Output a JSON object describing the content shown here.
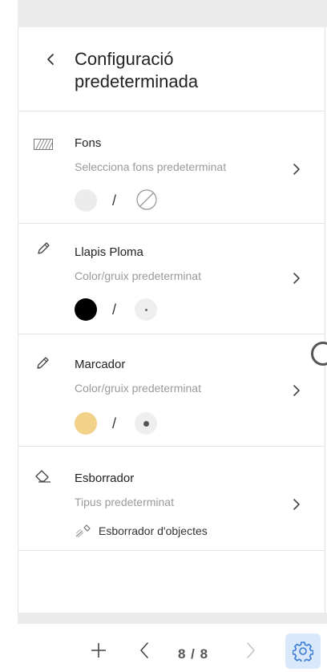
{
  "header": {
    "title": "Configuració predeterminada"
  },
  "sections": [
    {
      "title": "Fons",
      "subtitle": "Selecciona fons predeterminat",
      "icon": "background-pattern-icon",
      "preview": {
        "color": "#ececec",
        "separator": "/",
        "secondary": "no-pattern-icon"
      }
    },
    {
      "title": "Llapis Ploma",
      "subtitle": "Color/gruix predeterminat",
      "icon": "pen-icon",
      "preview": {
        "color": "#000000",
        "separator": "/",
        "secondary": "thin-thickness-dot"
      }
    },
    {
      "title": "Marcador",
      "subtitle": "Color/gruix predeterminat",
      "icon": "marker-icon",
      "preview": {
        "color": "#f2d188",
        "separator": "/",
        "secondary": "medium-thickness-dot"
      }
    },
    {
      "title": "Esborrador",
      "subtitle": "Tipus predeterminat",
      "icon": "eraser-icon",
      "option": {
        "label": "Esborrador d'objectes",
        "icon": "object-eraser-icon"
      }
    }
  ],
  "bottom_bar": {
    "page_indicator": "8 / 8",
    "buttons": [
      "add-page-icon",
      "previous-page-icon",
      "next-page-icon",
      "settings-icon"
    ],
    "settings_bg": "#d9e8fb"
  },
  "colors": {
    "accent": "#3a7bd5",
    "muted_text": "#9a9a9a",
    "divider": "#e4e4e4"
  }
}
